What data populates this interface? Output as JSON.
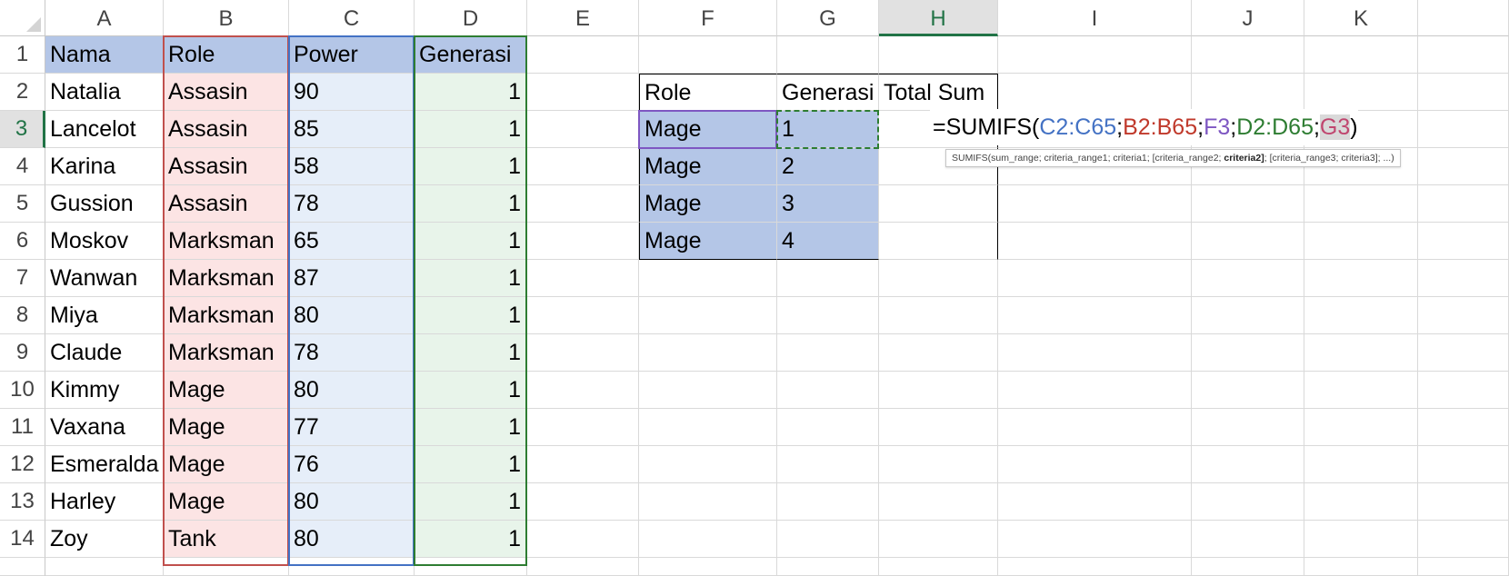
{
  "columns": [
    "A",
    "B",
    "C",
    "D",
    "E",
    "F",
    "G",
    "H",
    "I",
    "J",
    "K"
  ],
  "active_column": "H",
  "rows": [
    "1",
    "2",
    "3",
    "4",
    "5",
    "6",
    "7",
    "8",
    "9",
    "10",
    "11",
    "12",
    "13",
    "14"
  ],
  "active_row": "3",
  "data_table": {
    "headers": [
      "Nama",
      "Role",
      "Power",
      "Generasi"
    ],
    "rows": [
      [
        "Natalia",
        "Assasin",
        "90",
        "1"
      ],
      [
        "Lancelot",
        "Assasin",
        "85",
        "1"
      ],
      [
        "Karina",
        "Assasin",
        "58",
        "1"
      ],
      [
        "Gussion",
        "Assasin",
        "78",
        "1"
      ],
      [
        "Moskov",
        "Marksman",
        "65",
        "1"
      ],
      [
        "Wanwan",
        "Marksman",
        "87",
        "1"
      ],
      [
        "Miya",
        "Marksman",
        "80",
        "1"
      ],
      [
        "Claude",
        "Marksman",
        "78",
        "1"
      ],
      [
        "Kimmy",
        "Mage",
        "80",
        "1"
      ],
      [
        "Vaxana",
        "Mage",
        "77",
        "1"
      ],
      [
        "Esmeralda",
        "Mage",
        "76",
        "1"
      ],
      [
        "Harley",
        "Mage",
        "80",
        "1"
      ],
      [
        "Zoy",
        "Tank",
        "80",
        "1"
      ]
    ]
  },
  "summary_table": {
    "headers": [
      "Role",
      "Generasi",
      "Total Sum"
    ],
    "rows": [
      [
        "Mage",
        "1"
      ],
      [
        "Mage",
        "2"
      ],
      [
        "Mage",
        "3"
      ],
      [
        "Mage",
        "4"
      ]
    ]
  },
  "formula": {
    "prefix": "=SUMIFS(",
    "arg1": "C2:C65",
    "sep1": ";",
    "arg2": "B2:B65",
    "sep2": ";",
    "arg3": "F3",
    "sep3": ";",
    "arg4": "D2:D65",
    "sep4": ";",
    "arg5": "G3",
    "suffix": ")"
  },
  "tooltip": {
    "before": "SUMIFS(sum_range; criteria_range1; criteria1; [criteria_range2; ",
    "bold": "criteria2]",
    "after": "; [criteria_range3; criteria3]; ...)"
  },
  "colors": {
    "header_fill": "#b4c6e7",
    "role_fill": "#fce4e4",
    "role_border": "#c0504d",
    "power_fill": "#e6eef9",
    "power_border": "#4472c4",
    "gen_fill": "#e8f4ea",
    "gen_border": "#2e7d32",
    "selected_fill": "#b4c6e7",
    "arg1": "#4472c4",
    "arg2": "#c0392b",
    "arg3": "#7e57c2",
    "arg4": "#2e7d32",
    "arg5": "#c0466f"
  }
}
